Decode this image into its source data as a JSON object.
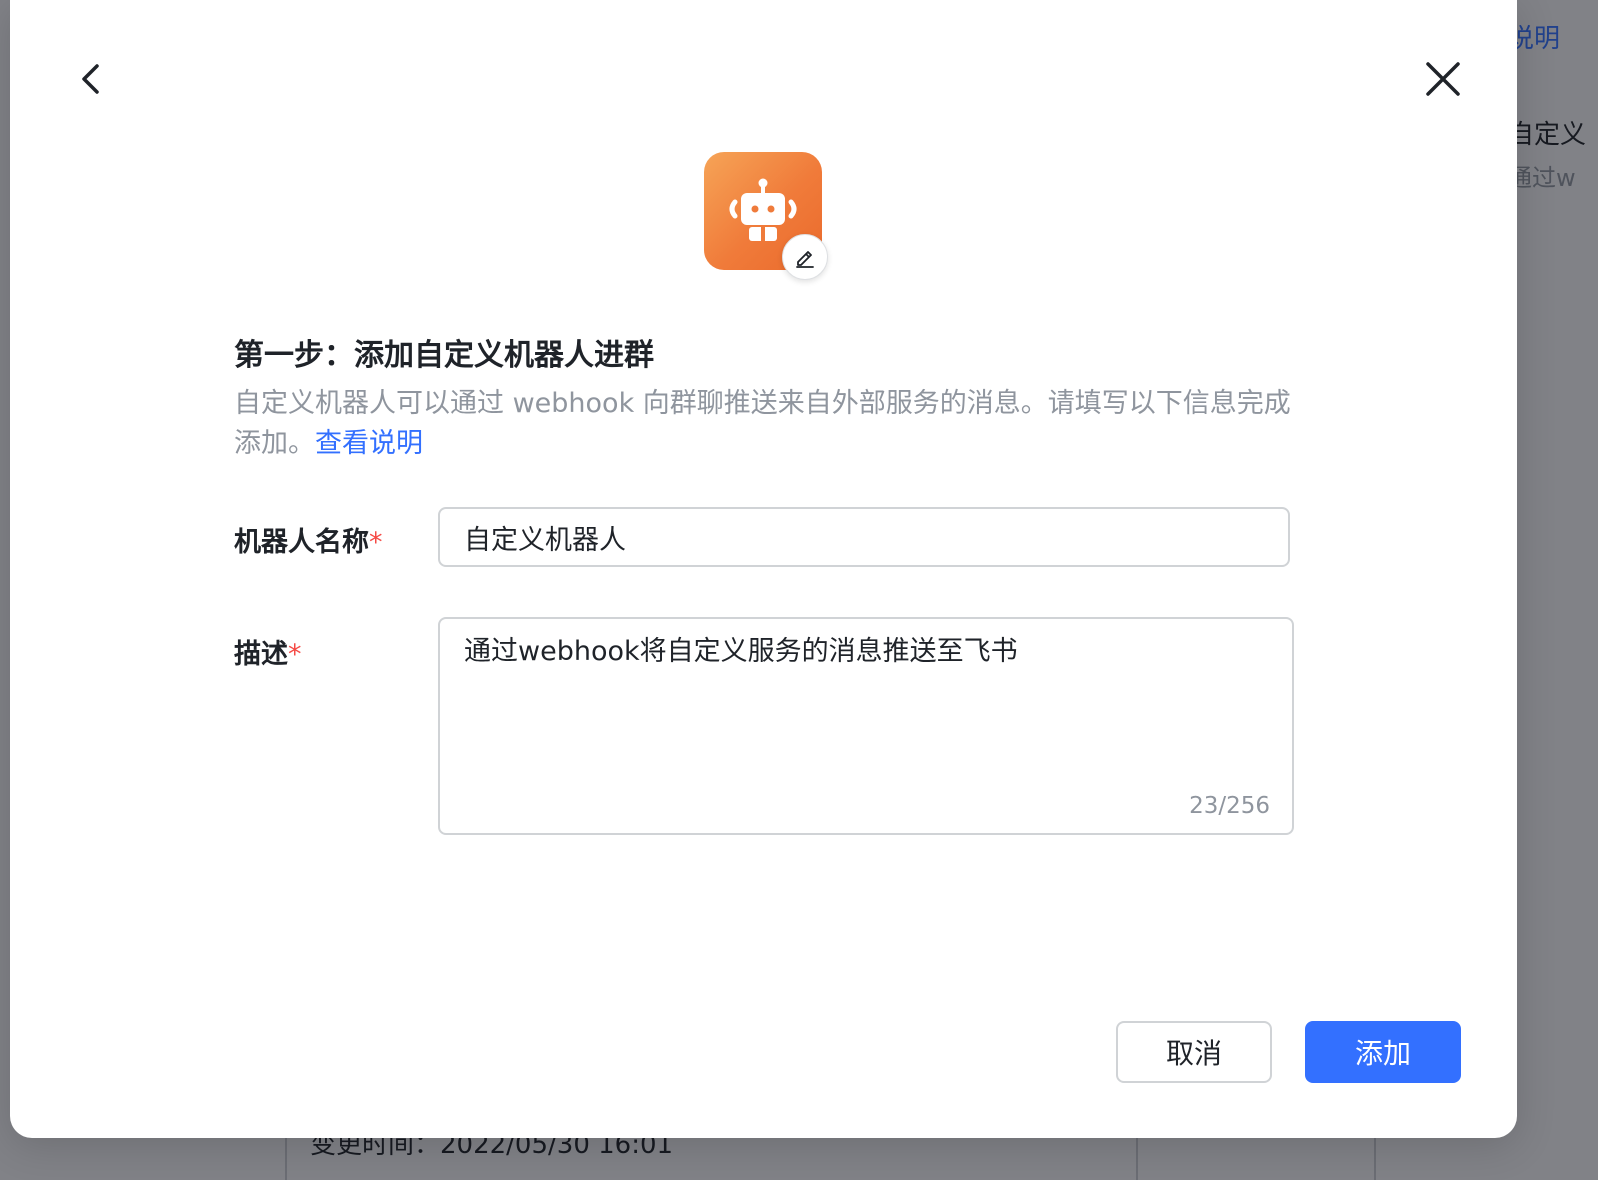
{
  "background": {
    "top_right_link": "说明",
    "card_title": "自定义",
    "card_subtitle": "通过w",
    "bottom_text": "变更时间：2022/05/30 16:01"
  },
  "modal": {
    "step_title": "第一步：添加自定义机器人进群",
    "step_desc": "自定义机器人可以通过 webhook 向群聊推送来自外部服务的消息。请填写以下信息完成添加。",
    "help_link": "查看说明",
    "name_label": "机器人名称",
    "required_mark": "*",
    "name_value": "自定义机器人",
    "desc_label": "描述",
    "desc_value": "通过webhook将自定义服务的消息推送至飞书",
    "desc_counter": "23/256",
    "cancel_label": "取消",
    "add_label": "添加"
  },
  "icons": {
    "back": "chevron-left-icon",
    "close": "close-icon",
    "avatar": "robot-icon",
    "edit": "pencil-icon"
  },
  "colors": {
    "primary": "#3370ff",
    "required": "#f54a45",
    "avatar_gradient_start": "#f6a457",
    "avatar_gradient_end": "#ea6a2c"
  }
}
